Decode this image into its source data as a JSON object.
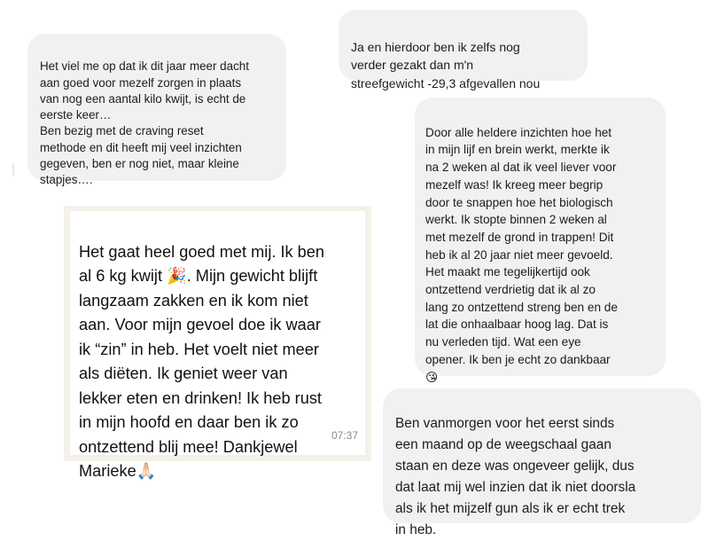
{
  "messages": {
    "left_top": "Het viel me op dat ik dit jaar meer dacht\naan goed voor mezelf zorgen in plaats\nvan nog een aantal kilo kwijt, is echt de\neerste keer…\nBen bezig met de craving reset\nmethode en dit heeft mij veel inzichten\ngegeven, ben er nog niet, maar kleine\nstapjes….",
    "right_top": "Ja en hierdoor ben ik zelfs nog\nverder gezakt dan m'n\nstreefgewicht  -29,3 afgevallen nou",
    "right_middle": "Door alle heldere inzichten hoe het\nin mijn lijf en brein werkt, merkte ik\nna 2 weken al dat ik veel liever voor\nmezelf was! Ik kreeg meer begrip\ndoor te snappen hoe het biologisch\nwerkt. Ik stopte binnen 2 weken al\nmet mezelf de grond in trappen! Dit\nheb ik al 20 jaar niet meer gevoeld.\nHet maakt me tegelijkertijd ook\nontzettend verdrietig dat ik al zo\nlang zo ontzettend streng ben en de\nlat die onhaalbaar hoog lag. Dat is\nnu verleden tijd. Wat een eye\nopener. Ik ben je echt zo dankbaar\n😘",
    "whatsapp": "Het gaat heel goed met mij. Ik ben\nal 6 kg kwijt 🎉. Mijn gewicht blijft\nlangzaam zakken en ik kom niet\naan. Voor mijn gevoel doe ik waar\nik “zin” in heb. Het voelt niet meer\nals diëten. Ik geniet weer van\nlekker eten en drinken! Ik heb rust\nin mijn hoofd en daar ben ik zo\nontzettend blij mee! Dankjewel\nMarieke🙏🏻",
    "whatsapp_time": "07:37",
    "right_bottom": "Ben vanmorgen voor het eerst sinds\neen maand op de weegschaal gaan\nstaan en deze was ongeveer gelijk, dus\ndat laat mij wel inzien dat ik niet doorsla\nals ik het mijzelf gun als ik er echt trek\nin heb."
  },
  "colors": {
    "bubble": "#f0f1f3",
    "whatsapp_frame": "#f4f1ea",
    "whatsapp_bubble": "#ffffff",
    "text": "#1c1c1c",
    "timestamp": "#8a8a8a"
  }
}
